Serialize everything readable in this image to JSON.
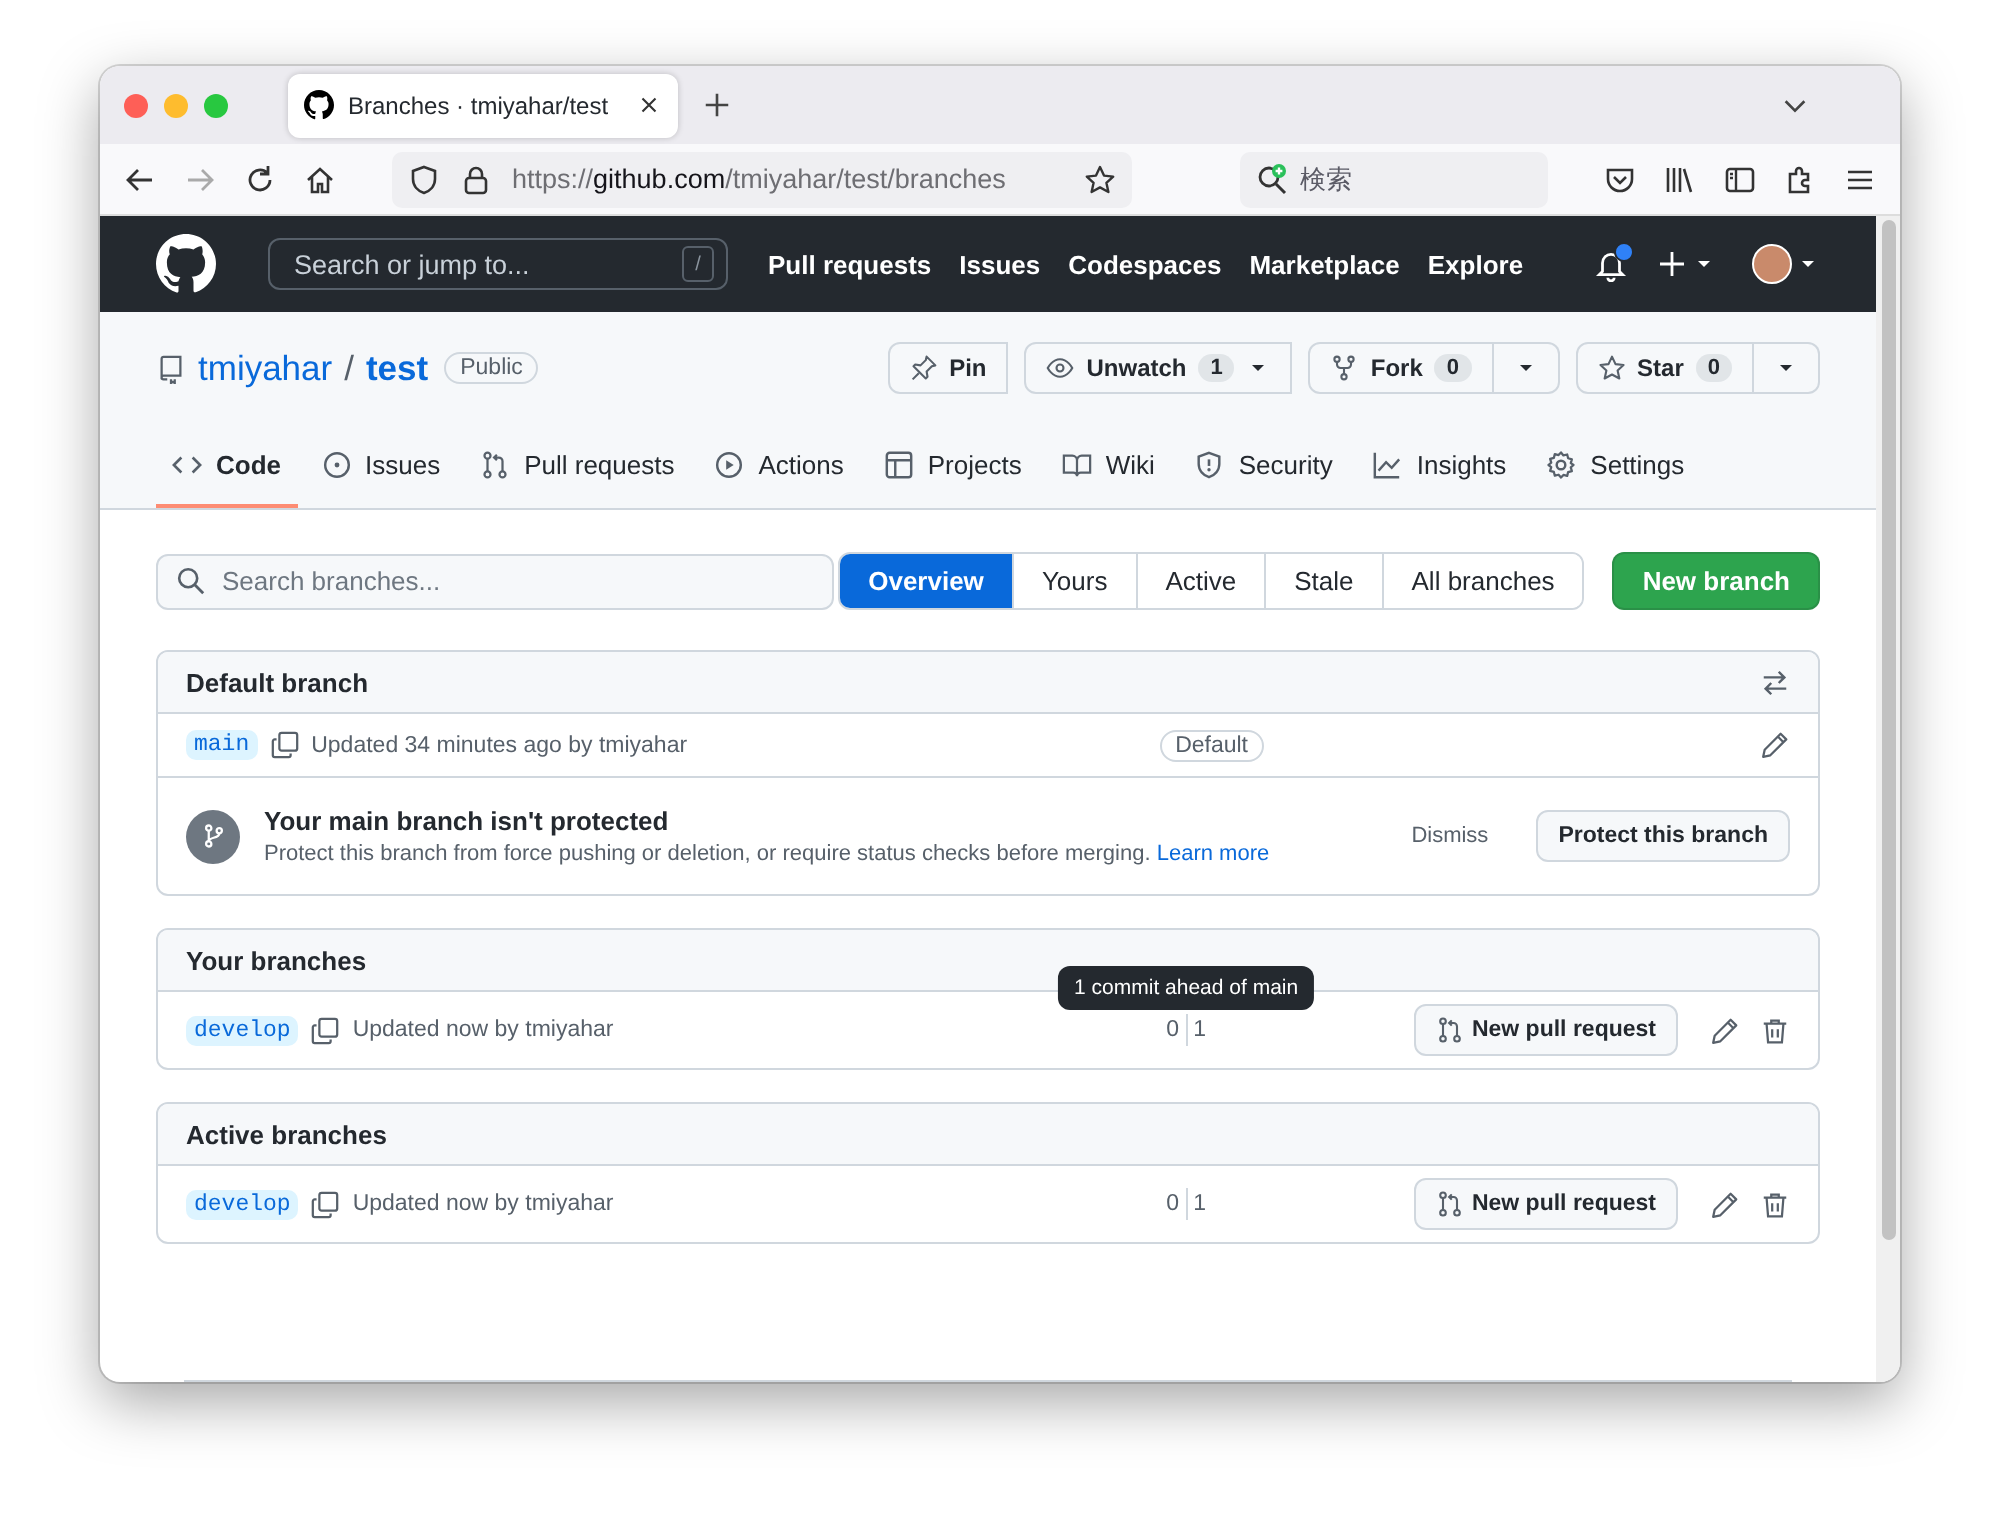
{
  "browser": {
    "tab_title": "Branches · tmiyahar/test",
    "url": "https://**github.com**/tmiyahar/test/branches",
    "search_placeholder": "検索"
  },
  "header": {
    "search_placeholder": "Search or jump to...",
    "shortcut": "/",
    "nav": [
      "Pull requests",
      "Issues",
      "Codespaces",
      "Marketplace",
      "Explore"
    ],
    "notification_unread": true
  },
  "repo": {
    "owner": "tmiyahar",
    "separator": "/",
    "name": "test",
    "visibility": "Public",
    "actions": [
      {
        "kind": "pin",
        "label": "Pin"
      },
      {
        "kind": "watch",
        "label": "Unwatch",
        "count": "1"
      },
      {
        "kind": "fork",
        "label": "Fork",
        "count": "0"
      },
      {
        "kind": "star",
        "label": "Star",
        "count": "0"
      }
    ]
  },
  "repo_tabs": [
    {
      "kind": "code",
      "label": "Code",
      "selected": true
    },
    {
      "kind": "issues",
      "label": "Issues",
      "selected": false
    },
    {
      "kind": "pulls",
      "label": "Pull requests",
      "selected": false
    },
    {
      "kind": "actions",
      "label": "Actions",
      "selected": false
    },
    {
      "kind": "projects",
      "label": "Projects",
      "selected": false
    },
    {
      "kind": "wiki",
      "label": "Wiki",
      "selected": false
    },
    {
      "kind": "security",
      "label": "Security",
      "selected": false
    },
    {
      "kind": "insights",
      "label": "Insights",
      "selected": false
    },
    {
      "kind": "settings",
      "label": "Settings",
      "selected": false
    }
  ],
  "branch_filter": {
    "placeholder": "Search branches...",
    "filters": [
      {
        "label": "Overview",
        "selected": true
      },
      {
        "label": "Yours",
        "selected": false
      },
      {
        "label": "Active",
        "selected": false
      },
      {
        "label": "Stale",
        "selected": false
      },
      {
        "label": "All branches",
        "selected": false
      }
    ],
    "new_branch": "New branch"
  },
  "default_branch": {
    "title": "Default branch",
    "branch": "main",
    "updated": "Updated 34 minutes ago by tmiyahar",
    "badge": "Default",
    "notice": {
      "title": "Your main branch isn't protected",
      "text": "Protect this branch from force pushing or deletion, or require status checks before merging.",
      "link": "Learn more",
      "dismiss": "Dismiss",
      "button": "Protect this branch"
    }
  },
  "sections": [
    {
      "title": "Your branches",
      "rows": [
        {
          "branch": "develop",
          "updated": "Updated now by tmiyahar",
          "behind": "0",
          "ahead": "1",
          "tooltip": "1 commit ahead of main",
          "button": "New pull request"
        }
      ]
    },
    {
      "title": "Active branches",
      "rows": [
        {
          "branch": "develop",
          "updated": "Updated now by tmiyahar",
          "behind": "0",
          "ahead": "1",
          "button": "New pull request"
        }
      ]
    }
  ]
}
